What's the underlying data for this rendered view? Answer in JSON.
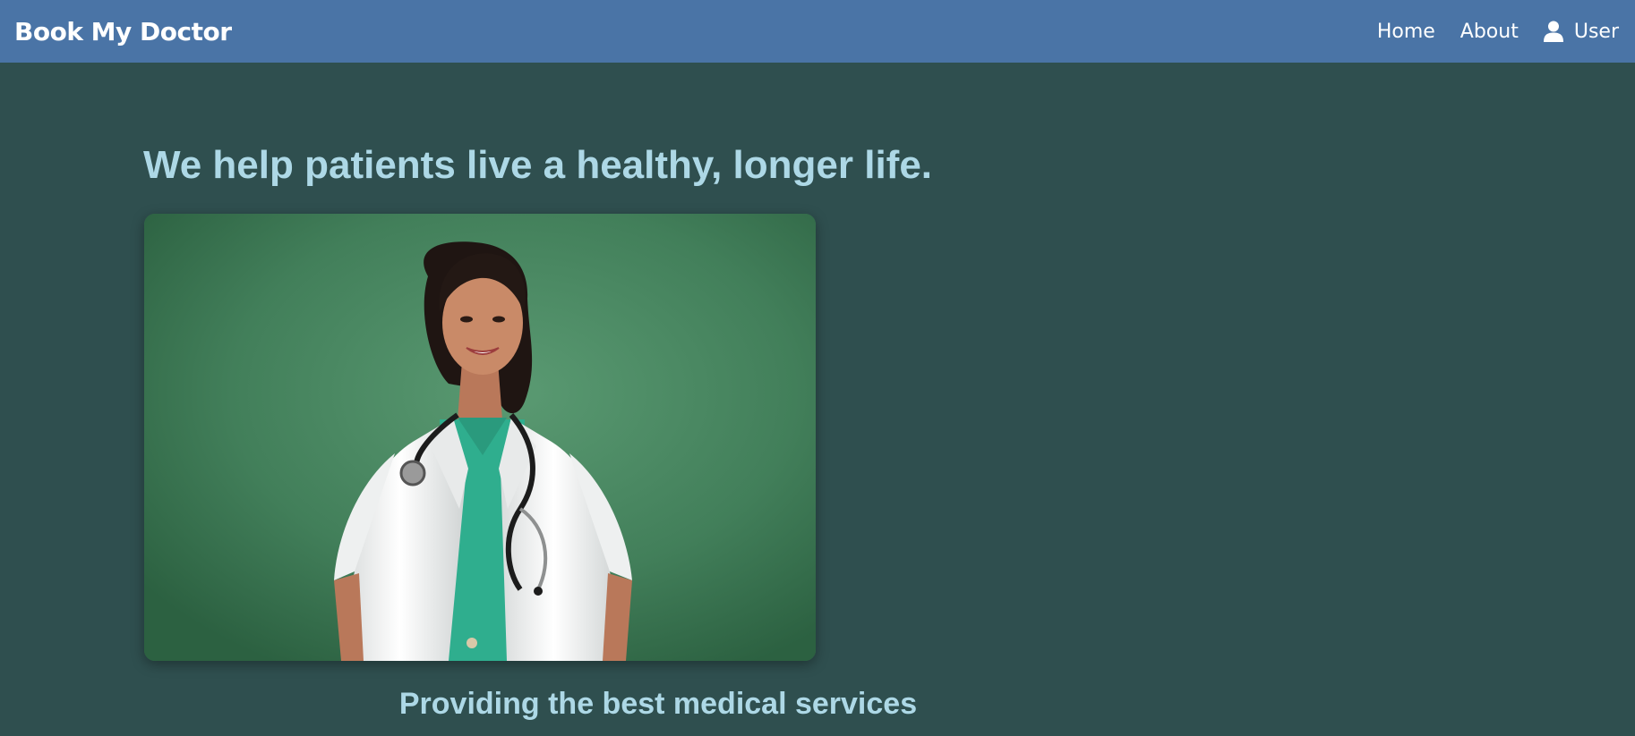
{
  "navbar": {
    "brand": "Book My Doctor",
    "links": {
      "home": "Home",
      "about": "About",
      "user": "User"
    },
    "background_color": "#4a74a6"
  },
  "hero": {
    "title": "We help patients live a healthy, longer life.",
    "image_alt": "Smiling doctor in white coat with stethoscope on green background",
    "subtitle": "Providing the best medical services",
    "text_color": "#add8e6"
  },
  "page": {
    "background_color": "#2f4f4f"
  },
  "icons": {
    "user": "user-icon"
  }
}
